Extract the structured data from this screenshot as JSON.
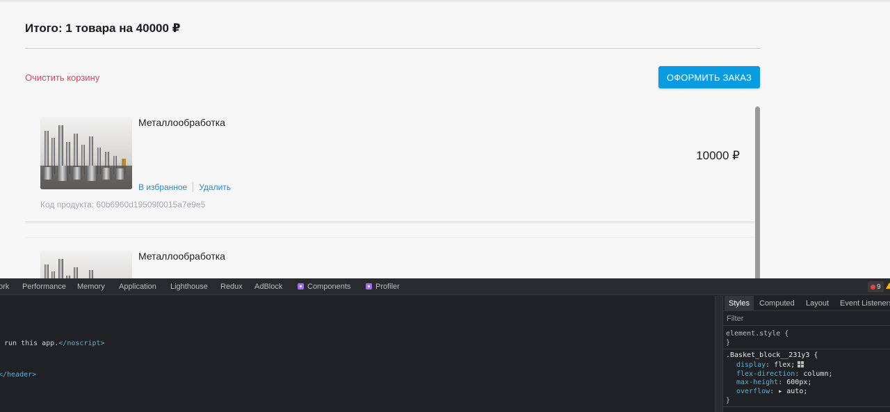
{
  "basket": {
    "summary": "Итого: 1 товара на 40000 ₽",
    "clear_label": "Очистить корзину",
    "order_label": "ОФОРМИТЬ ЗАКАЗ"
  },
  "items": [
    {
      "name": "Металлообработка",
      "price": "10000 ₽",
      "favorite_label": "В избранное",
      "delete_label": "Удалить",
      "code": "Код продукта: 60b6960d19509f0015a7e9e5"
    },
    {
      "name": "Металлообработка"
    }
  ],
  "devtools": {
    "tabs": [
      "ork",
      "Performance",
      "Memory",
      "Application",
      "Lighthouse",
      "Redux",
      "AdBlock",
      "Components",
      "Profiler"
    ],
    "error_count": "9",
    "code_lines": {
      "line1_text": "run this app.",
      "line1_tag": "</noscript>",
      "line2_tag": "</header>"
    },
    "styles_tabs": [
      "Styles",
      "Computed",
      "Layout",
      "Event Listeners"
    ],
    "filter_placeholder": "Filter",
    "element_style": "element.style {",
    "close_brace": "}",
    "rule_selector": ".Basket_block__231y3 {",
    "rule_props": [
      {
        "name": "display",
        "value": "flex;"
      },
      {
        "name": "flex-direction",
        "value": "column;"
      },
      {
        "name": "max-height",
        "value": "600px;"
      },
      {
        "name": "overflow",
        "value": "▸ auto;"
      }
    ]
  },
  "colors": {
    "accent": "#0a9be0",
    "danger": "#e4405a",
    "link": "#2f86c8"
  }
}
